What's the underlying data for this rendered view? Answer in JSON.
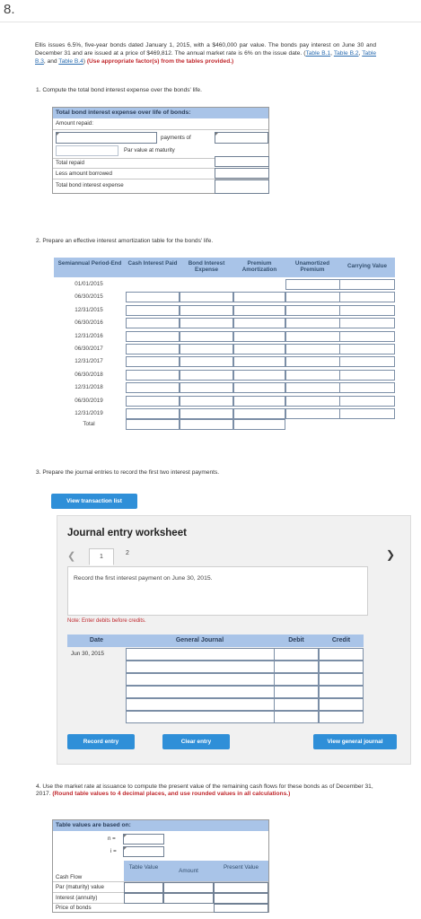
{
  "question_number": "8.",
  "intro": {
    "text_before_links": "Ellis issues 6.5%, five-year bonds dated January 1, 2015, with a $460,000 par value. The bonds pay interest on June 30 and December 31 and are issued at a price of $469,812. The annual market rate is 6% on the issue date. (",
    "link1": "Table B.1",
    "sep1": ", ",
    "link2": "Table B.2",
    "sep2": ", ",
    "link3": "Table B.3",
    "sep3": ", and ",
    "link4": "Table B.4",
    "after_links": ")",
    "instruction": "(Use appropriate factor(s) from the tables provided.)"
  },
  "part1": {
    "question": "1. Compute the total bond interest expense over the bonds' life.",
    "table_title": "Total bond interest expense over life of bonds:",
    "amount_repaid_label": "Amount repaid:",
    "payments_of_label": "payments of",
    "par_value_label": "Par value at maturity",
    "total_repaid_label": "Total repaid",
    "less_borrowed_label": "Less amount borrowed",
    "total_expense_label": "Total bond interest expense"
  },
  "part2": {
    "question": "2. Prepare an effective interest amortization table for the bonds' life.",
    "headers": [
      "Semiannual Period-End",
      "Cash Interest Paid",
      "Bond Interest Expense",
      "Premium Amortization",
      "Unamortized Premium",
      "Carrying Value"
    ],
    "dates": [
      "01/01/2015",
      "06/30/2015",
      "12/31/2015",
      "06/30/2016",
      "12/31/2016",
      "06/30/2017",
      "12/31/2017",
      "06/30/2018",
      "12/31/2018",
      "06/30/2019",
      "12/31/2019"
    ],
    "total_label": "Total"
  },
  "part3": {
    "question": "3. Prepare the journal entries to record the first two interest payments.",
    "view_transaction_list": "View transaction list"
  },
  "worksheet": {
    "title": "Journal entry worksheet",
    "tabs": [
      "1",
      "2"
    ],
    "description": "Record the first interest payment on June 30, 2015.",
    "note": "Note: Enter debits before credits.",
    "columns": [
      "Date",
      "General Journal",
      "Debit",
      "Credit"
    ],
    "first_date": "Jun 30, 2015",
    "record_entry": "Record entry",
    "clear_entry": "Clear entry",
    "view_general_journal": "View general journal"
  },
  "part4": {
    "question": "4. Use the market rate at issuance to compute the present value of the remaining cash flows for these bonds as of December 31, 2017. ",
    "instruction": "(Round table values to 4 decimal places, and use rounded values in all calculations.)",
    "table_title": "Table values are based on:",
    "n_label": "n =",
    "i_label": "i =",
    "col_cash_flow": "Cash Flow",
    "col_table_value": "Table Value",
    "col_amount": "Amount",
    "col_present_value": "Present Value",
    "rows": [
      "Par (maturity) value",
      "Interest (annuity)",
      "Price of bonds"
    ]
  }
}
